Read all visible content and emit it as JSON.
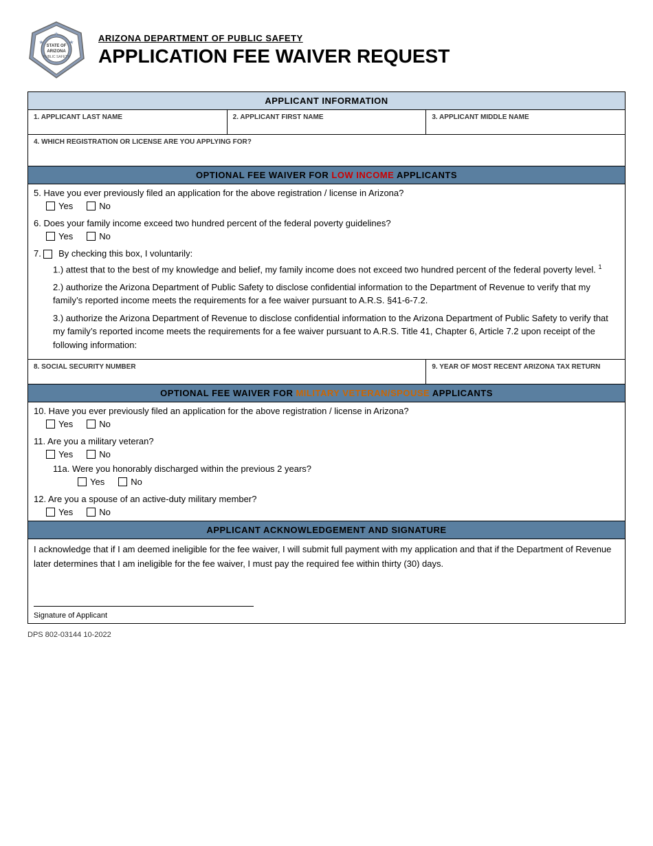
{
  "header": {
    "dept_name": "ARIZONA DEPARTMENT OF PUBLIC SAFETY",
    "form_title": "APPLICATION FEE WAIVER REQUEST"
  },
  "sections": {
    "applicant_info_header": "APPLICANT INFORMATION",
    "optional_low_income_header_1": "OPTIONAL FEE WAIVER FOR ",
    "optional_low_income_highlight": "LOW INCOME",
    "optional_low_income_header_2": " APPLICANTS",
    "optional_military_header_1": "OPTIONAL FEE WAIVER FOR ",
    "optional_military_highlight": "MILITARY VETERAN/SPOUSE",
    "optional_military_header_2": " APPLICANTS",
    "acknowledgement_header": "APPLICANT ACKNOWLEDGEMENT AND SIGNATURE"
  },
  "fields": {
    "f1_label": "1.  APPLICANT LAST NAME",
    "f2_label": "2.  APPLICANT FIRST NAME",
    "f3_label": "3.  APPLICANT MIDDLE NAME",
    "f4_label": "4.  WHICH REGISTRATION OR LICENSE ARE YOU APPLYING FOR?",
    "f8_label": "8.  SOCIAL SECURITY NUMBER",
    "f9_label": "9.  YEAR OF MOST RECENT ARIZONA TAX RETURN"
  },
  "questions": {
    "q5": "5.  Have you ever previously filed an application for the above registration / license in Arizona?",
    "q5_yes": "Yes",
    "q5_no": "No",
    "q6": "6.  Does your family income exceed two hundred percent of the federal poverty guidelines?",
    "q6_yes": "Yes",
    "q6_no": "No",
    "q7": "7.  □ By checking this box, I voluntarily:",
    "q7_1": "1.) attest that to the best of my knowledge and belief, my family income does not exceed two hundred percent of the federal poverty level.",
    "q7_1_sup": "1",
    "q7_2": "2.) authorize the Arizona Department of Public Safety to disclose confidential information to the Department of Revenue to verify that my family’s reported income meets the requirements for a fee waiver pursuant to A.R.S. §41-6-7.2.",
    "q7_3": "3.) authorize the Arizona Department of Revenue to disclose confidential information to the Arizona Department of Public Safety to verify that my family’s reported income meets the requirements for a fee waiver pursuant to A.R.S. Title 41, Chapter 6, Article 7.2 upon receipt of the following information:",
    "q10": "10.  Have you ever previously filed an application for the above registration / license in Arizona?",
    "q10_yes": "Yes",
    "q10_no": "No",
    "q11": "11.  Are you a military veteran?",
    "q11_yes": "Yes",
    "q11_no": "No",
    "q11a": "11a.  Were you honorably discharged within the previous 2 years?",
    "q11a_yes": "Yes",
    "q11a_no": "No",
    "q12": "12.  Are you a spouse of an active-duty military member?",
    "q12_yes": "Yes",
    "q12_no": "No"
  },
  "acknowledgement": {
    "text": "I acknowledge that if I am deemed ineligible for the fee waiver, I will submit full payment with my application and that if the Department of Revenue later determines that I am ineligible for the fee waiver, I must pay the required fee within thirty (30) days."
  },
  "signature": {
    "label": "Signature of Applicant"
  },
  "footer": {
    "form_number": "DPS 802-03144",
    "date": "10-2022"
  }
}
